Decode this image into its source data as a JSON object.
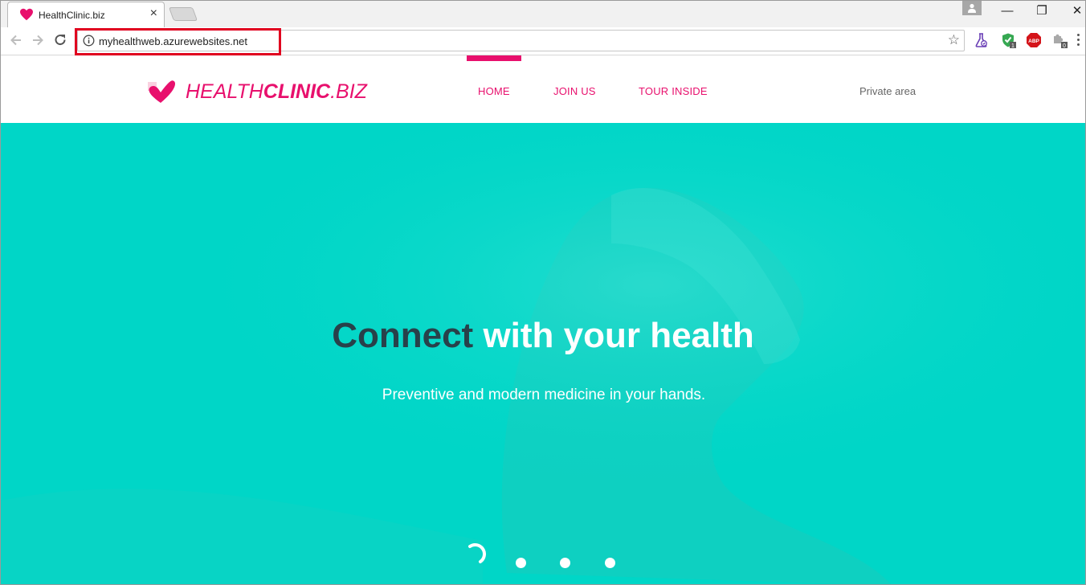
{
  "browser": {
    "tab_title": "HealthClinic.biz",
    "tab_close": "×",
    "url": "myhealthweb.azurewebsites.net",
    "bookmark_star": "☆",
    "window_controls": {
      "minimize": "—",
      "restore": "❐",
      "close": "✕"
    },
    "extensions": [
      {
        "icon": "flask-icon"
      },
      {
        "icon": "shield-check-icon",
        "badge": "1"
      },
      {
        "icon": "adblock-icon",
        "label": "ABP"
      },
      {
        "icon": "puzzle-icon",
        "badge": "0"
      }
    ]
  },
  "site": {
    "logo": {
      "part1": "HEALTH",
      "part2": "CLINIC",
      "part3": ".BIZ"
    },
    "nav": [
      {
        "label": "HOME",
        "active": true
      },
      {
        "label": "JOIN US",
        "active": false
      },
      {
        "label": "TOUR INSIDE",
        "active": false
      }
    ],
    "private_area": "Private area",
    "brand_color": "#e8106d",
    "hero_color": "#00d6c7"
  },
  "hero": {
    "headline_dark": "Connect",
    "headline_light": "with your health",
    "subtitle": "Preventive and modern medicine in your hands.",
    "carousel_dots": 3
  }
}
